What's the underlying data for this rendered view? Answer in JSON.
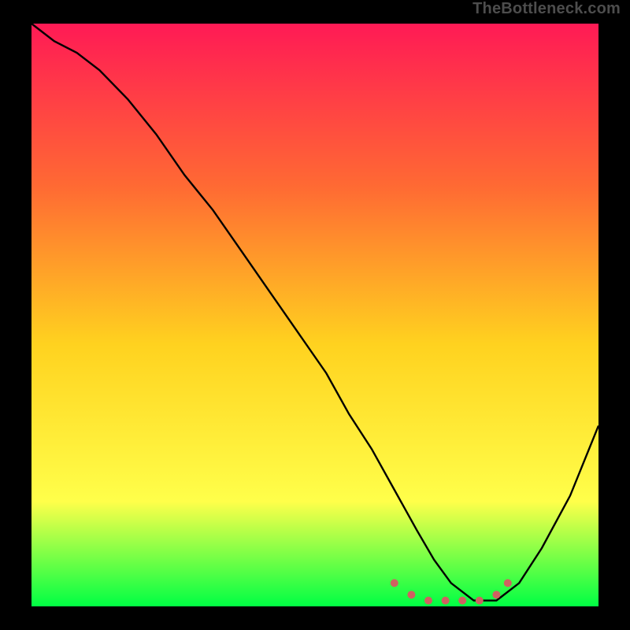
{
  "watermark": "TheBottleneck.com",
  "colors": {
    "background": "#000000",
    "gradient_top": "#ff1a55",
    "gradient_mid1": "#ff6a33",
    "gradient_mid2": "#ffd21f",
    "gradient_mid3": "#ffff4a",
    "gradient_bottom": "#00ff44",
    "curve": "#000000",
    "dots": "#cf6161"
  },
  "chart_data": {
    "type": "line",
    "title": "",
    "xlabel": "",
    "ylabel": "",
    "xlim": [
      0,
      100
    ],
    "ylim": [
      0,
      100
    ],
    "series": [
      {
        "name": "bottleneck-curve",
        "x": [
          0,
          4,
          8,
          12,
          17,
          22,
          27,
          32,
          37,
          42,
          47,
          52,
          56,
          60,
          64,
          68,
          71,
          74,
          78,
          82,
          86,
          90,
          95,
          100
        ],
        "y": [
          100,
          97,
          95,
          92,
          87,
          81,
          74,
          68,
          61,
          54,
          47,
          40,
          33,
          27,
          20,
          13,
          8,
          4,
          1,
          1,
          4,
          10,
          19,
          31
        ]
      }
    ],
    "markers": {
      "name": "valley-dots",
      "x": [
        64,
        67,
        70,
        73,
        76,
        79,
        82,
        84
      ],
      "y": [
        4,
        2,
        1,
        1,
        1,
        1,
        2,
        4
      ]
    }
  }
}
